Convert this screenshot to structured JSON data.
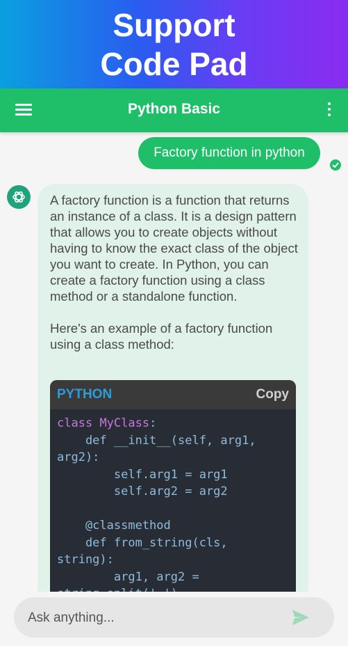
{
  "banner": {
    "line1": "Support",
    "line2": "Code Pad"
  },
  "appbar": {
    "title": "Python Basic"
  },
  "chat": {
    "user_message": "Factory function in python",
    "bot_paragraph1": "A factory function is a function that returns an instance of a class. It is a design pattern that allows you to create objects without having to know the exact class of the object you want to create. In Python, you can create a factory function using a class method or a standalone function.",
    "bot_paragraph2": "Here's an example of a factory function using a class method:",
    "code_language": "PYTHON",
    "copy_label": "Copy"
  },
  "input": {
    "placeholder": "Ask anything..."
  },
  "colors": {
    "accent": "#1fbf6a",
    "bubble_bg": "#e0f2e9",
    "code_bg": "#282c34"
  }
}
